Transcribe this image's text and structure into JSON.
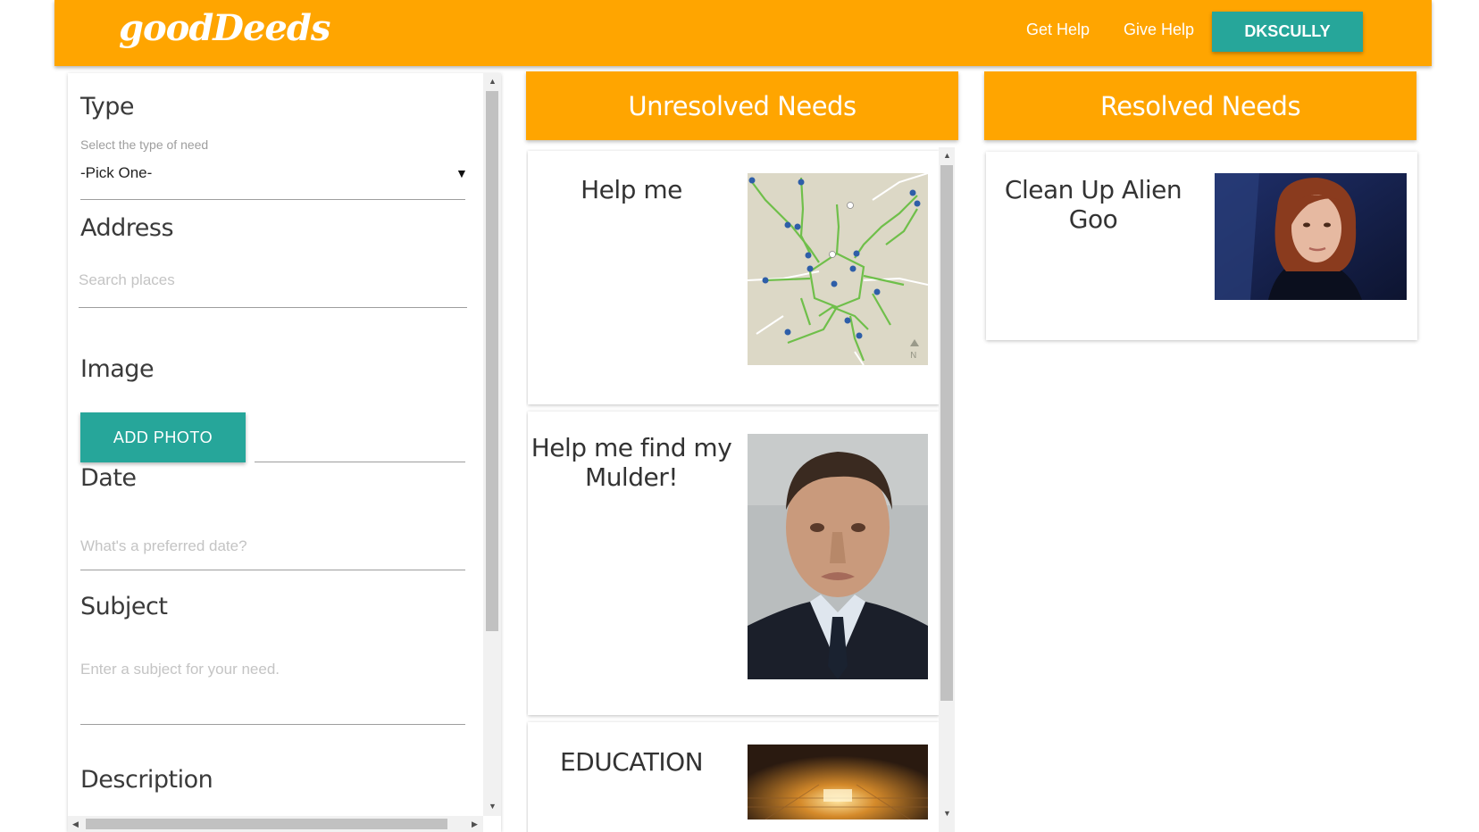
{
  "header": {
    "logo": "goodDeeds",
    "nav": {
      "get_help": "Get Help",
      "give_help": "Give Help"
    },
    "user_button": "DKSCULLY",
    "background_color": "#ffa500",
    "accent_color": "#26a69a"
  },
  "form": {
    "type": {
      "title": "Type",
      "label": "Select the type of need",
      "selected": "-Pick One-"
    },
    "address": {
      "title": "Address",
      "placeholder": "Search places"
    },
    "image": {
      "title": "Image",
      "button": "ADD PHOTO"
    },
    "date": {
      "title": "Date",
      "placeholder": "What's a preferred date?"
    },
    "subject": {
      "title": "Subject",
      "placeholder": "Enter a subject for your need."
    },
    "description": {
      "title": "Description"
    }
  },
  "unresolved": {
    "header": "Unresolved Needs",
    "cards": [
      {
        "title": "Help me",
        "image": "map-image"
      },
      {
        "title": "Help me find my Mulder!",
        "image": "man-portrait-image"
      },
      {
        "title": "EDUCATION",
        "image": "lecture-hall-image"
      }
    ]
  },
  "resolved": {
    "header": "Resolved Needs",
    "cards": [
      {
        "title": "Clean Up Alien Goo",
        "image": "woman-portrait-image"
      }
    ]
  }
}
